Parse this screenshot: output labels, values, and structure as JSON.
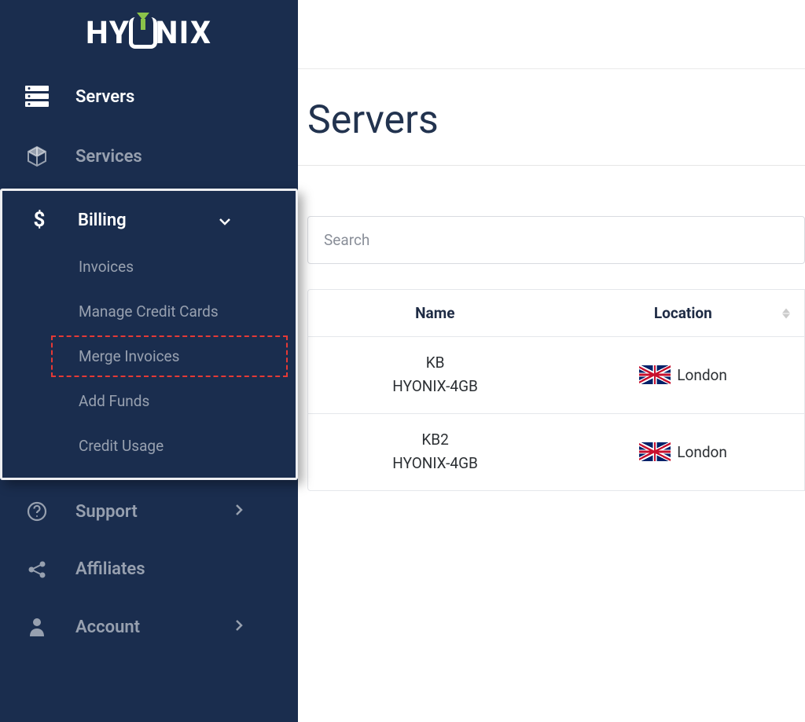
{
  "brand": "HYONIX",
  "sidebar": {
    "items": [
      {
        "label": "Servers"
      },
      {
        "label": "Services"
      },
      {
        "label": "Billing"
      },
      {
        "label": "Support"
      },
      {
        "label": "Affiliates"
      },
      {
        "label": "Account"
      }
    ],
    "billing_sub": [
      {
        "label": "Invoices"
      },
      {
        "label": "Manage Credit Cards"
      },
      {
        "label": "Merge Invoices"
      },
      {
        "label": "Add Funds"
      },
      {
        "label": "Credit Usage"
      }
    ]
  },
  "page": {
    "title": "Servers",
    "search_placeholder": "Search"
  },
  "table": {
    "headers": {
      "name": "Name",
      "location": "Location"
    },
    "rows": [
      {
        "name_line1": "KB",
        "name_line2": "HYONIX-4GB",
        "location": "London"
      },
      {
        "name_line1": "KB2",
        "name_line2": "HYONIX-4GB",
        "location": "London"
      }
    ]
  }
}
